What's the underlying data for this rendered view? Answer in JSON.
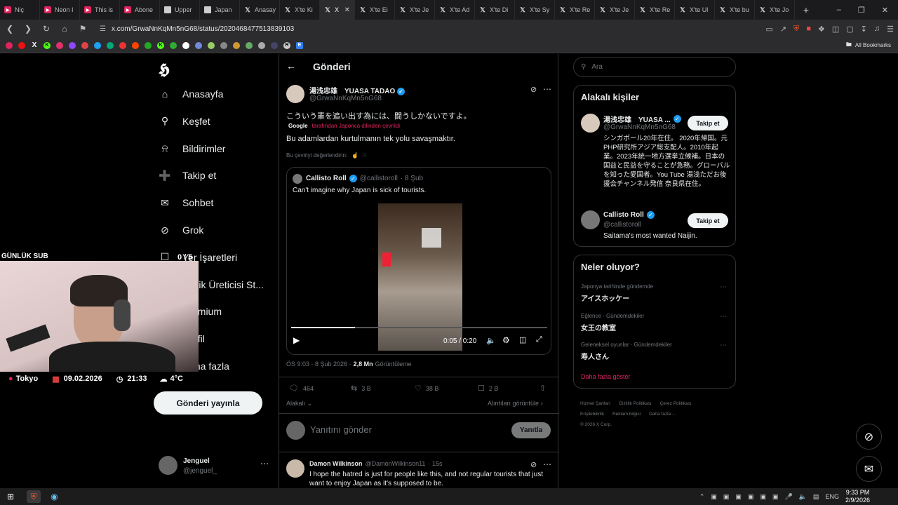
{
  "browser": {
    "tabs": [
      {
        "icon": "youtube",
        "title": "Niç"
      },
      {
        "icon": "youtube",
        "title": "Neon I"
      },
      {
        "icon": "youtube",
        "title": "This is"
      },
      {
        "icon": "youtube",
        "title": "Abone"
      },
      {
        "icon": "doc",
        "title": "Upper"
      },
      {
        "icon": "doc",
        "title": "Japan"
      },
      {
        "icon": "x",
        "title": "Anasay"
      },
      {
        "icon": "x",
        "title": "X'te Ki"
      },
      {
        "icon": "x",
        "title": "X",
        "active": true
      },
      {
        "icon": "x",
        "title": "X'te Ei"
      },
      {
        "icon": "x",
        "title": "X'te Je"
      },
      {
        "icon": "x",
        "title": "X'te Ad"
      },
      {
        "icon": "x",
        "title": "X'te Di"
      },
      {
        "icon": "x",
        "title": "X'te Sy"
      },
      {
        "icon": "x",
        "title": "X'te Re"
      },
      {
        "icon": "x",
        "title": "X'te Je"
      },
      {
        "icon": "x",
        "title": "X'te Re"
      },
      {
        "icon": "x",
        "title": "X'te Ul"
      },
      {
        "icon": "x",
        "title": "X'te bu"
      },
      {
        "icon": "x",
        "title": "X'te Jo"
      }
    ],
    "url": "x.com/GrwaNnKqMn5nG68/status/2020468477513839103",
    "all_bookmarks": "All Bookmarks",
    "accent": "#e0245e"
  },
  "nav": {
    "items": [
      {
        "label": "Anasayfa",
        "icon": "home-icon"
      },
      {
        "label": "Keşfet",
        "icon": "search-icon"
      },
      {
        "label": "Bildirimler",
        "icon": "bell-icon"
      },
      {
        "label": "Takip et",
        "icon": "person-plus-icon"
      },
      {
        "label": "Sohbet",
        "icon": "mail-icon"
      },
      {
        "label": "Grok",
        "icon": "grok-icon"
      },
      {
        "label": "Yer İşaretleri",
        "icon": "bookmark-icon"
      },
      {
        "label": "İçerik Üreticisi St...",
        "icon": "creator-icon"
      },
      {
        "label": "Premium",
        "icon": "premium-icon"
      },
      {
        "label": "Profil",
        "icon": "profile-icon"
      },
      {
        "label": "Daha fazla",
        "icon": "more-icon"
      }
    ],
    "post_button": "Gönderi yayınla",
    "account": {
      "name": "Jenguel",
      "handle": "@jenguel_"
    }
  },
  "header": {
    "title": "Gönderi"
  },
  "tweet": {
    "author_name": "湯浅忠雄　YUASA TADAO",
    "author_handle": "@GrwaNnKqMn5nG68",
    "text_original": "こういう輩を追い出す為には、闘うしかないですよ。",
    "translated_by_google": "Google",
    "translated_note": "tarafından Japonca dilinden çevrildi",
    "text_translated": "Bu adamlardan kurtulmanın tek yolu savaşmaktır.",
    "rate_translation": "Bu çeviriyi değerlendirin:",
    "timestamp": "ÖS 9:03 · 8 Şub 2026 ·",
    "views": "2,8 Mn",
    "views_label": "Görüntüleme",
    "replies": "464",
    "reposts": "3 B",
    "likes": "38 B",
    "bookmarks": "2 B",
    "translate_label": "Alakalı",
    "quotes_link": "Alıntıları görüntüle"
  },
  "quote": {
    "name": "Callisto Roll",
    "handle": "@callistoroll",
    "date": "· 8 Şub",
    "text": "Can't imagine why Japan is sick of tourists.",
    "video_time": "0:05 / 0:20",
    "video_progress": 0.25
  },
  "reply_box": {
    "placeholder": "Yanıtını gönder",
    "button": "Yanıtla"
  },
  "reply": {
    "name": "Damon Wilkinson",
    "handle": "@DamonWilkinson11",
    "time": "· 15s",
    "text": "I hope the hatred is just for people like this, and not regular tourists that just want to enjoy Japan as it's supposed to be."
  },
  "right": {
    "search_placeholder": "Ara",
    "related_title": "Alakalı kişiler",
    "people": [
      {
        "name": "湯浅忠雄　YUASA ...",
        "handle": "@GrwaNnKqMn5nG68",
        "bio": "シンガポール20年在住。 2020年帰国。元PHP研究所アジア総支配人。2010年起業。2023年統一地方選挙立候補。日本の国益と民益を守ることが急務。グローバルを知った愛国者。You Tube 湯浅ただお後援会チャンネル発信 奈良県在住。",
        "follow": "Takip et"
      },
      {
        "name": "Callisto Roll",
        "handle": "@callistoroll",
        "bio": "Saitama's most wanted Naijin.",
        "follow": "Takip et"
      }
    ],
    "trends_title": "Neler oluyor?",
    "trends": [
      {
        "context": "Japonya tarihinde gündemde",
        "topic": "アイスホッケー"
      },
      {
        "context": "Eğlence · Gündemdekiler",
        "topic": "女王の教室"
      },
      {
        "context": "Geleneksel oyunlar · Gündemdekiler",
        "topic": "寿人さん"
      }
    ],
    "show_more": "Daha fazla göster",
    "footer_links": [
      "Hizmet Şartları",
      "Gizlilik Politikası",
      "Çerez Politikası",
      "Erişilebilirlik",
      "Reklam bilgisi",
      "Daha fazla ..."
    ],
    "copyright": "© 2026 X Corp."
  },
  "overlay": {
    "sub_label": "GÜNLÜK SUB",
    "sub_count": "0 / 5",
    "city": "Tokyo",
    "date": "09.02.2026",
    "time": "21:33",
    "temp": "4°C"
  },
  "taskbar": {
    "lang": "ENG",
    "clock_time": "9:33 PM",
    "clock_date": "2/9/2026"
  }
}
